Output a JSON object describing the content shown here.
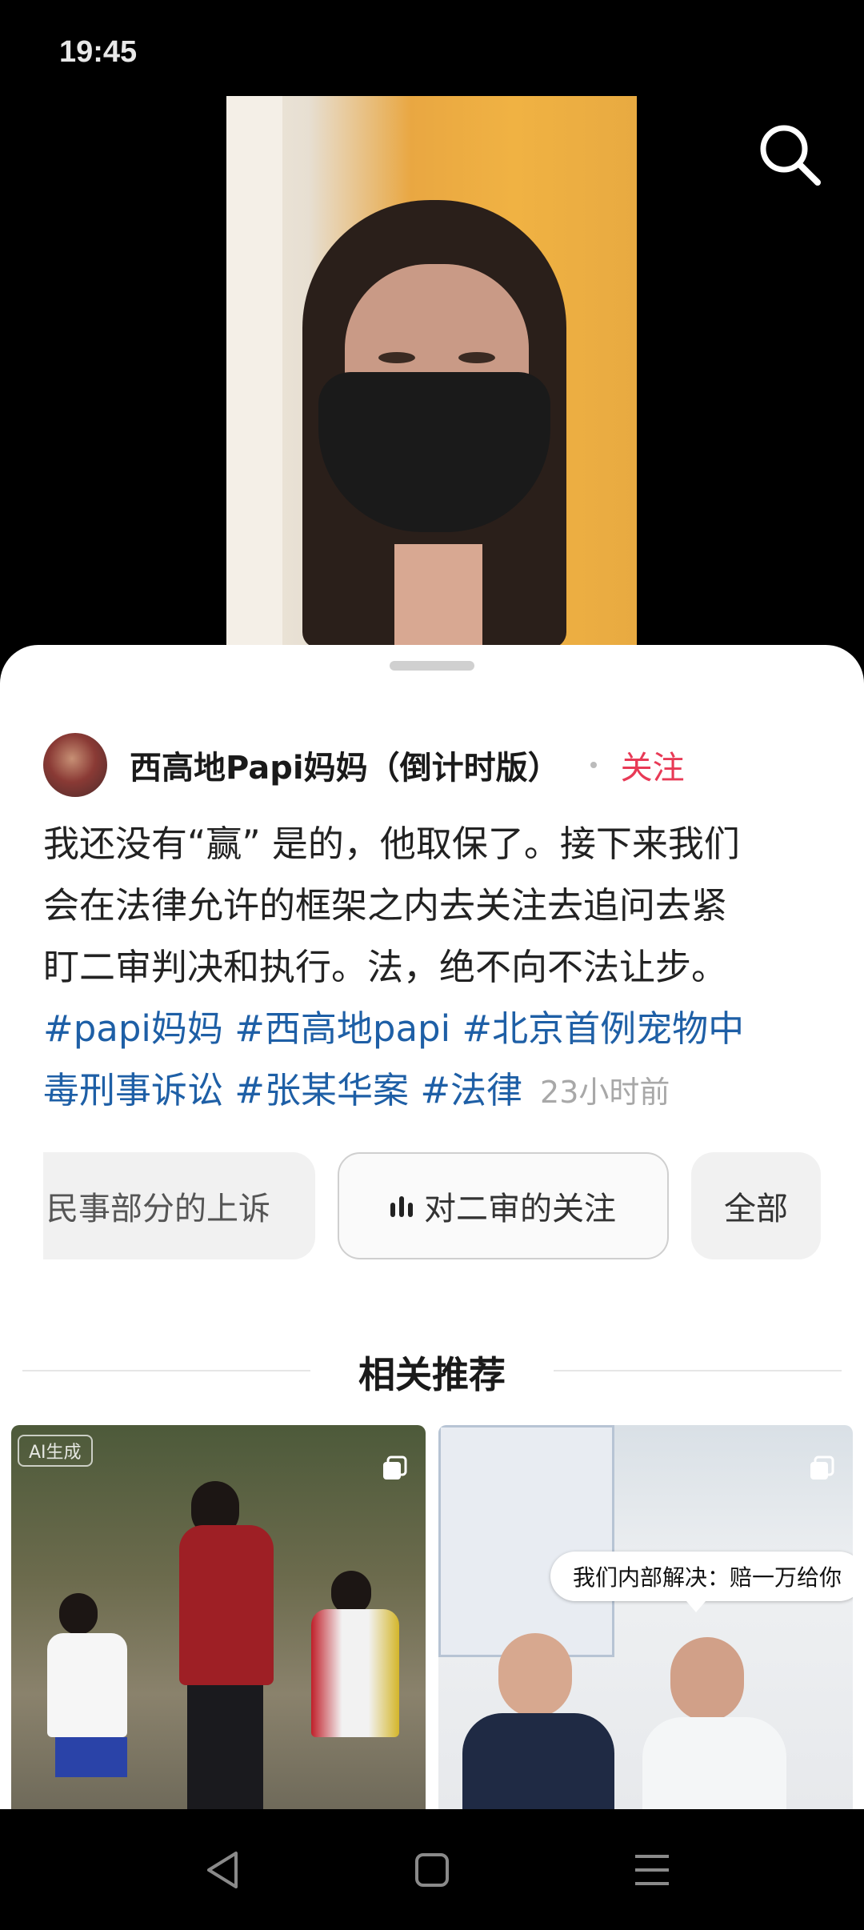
{
  "status_bar": {
    "time": "19:45"
  },
  "video": {
    "search_icon": "search-icon"
  },
  "post": {
    "author_name": "西高地Papi妈妈（倒计时版）",
    "follow_label": "关注",
    "text_lines": [
      "我还没有“赢” 是的，他取保了。接下来我们",
      "会在法律允许的框架之内去关注去追问去紧",
      "盯二审判决和执行。法，绝不向不法让步。"
    ],
    "tags_line1": "#papi妈妈 #西高地papi #北京首例宠物中",
    "tags_line2": "毒刑事诉讼 #张某华案 #法律",
    "time_ago": "23小时前"
  },
  "chips": [
    {
      "label": "民事部分的上诉"
    },
    {
      "label": "对二审的关注",
      "icon": "audio-bars-icon"
    },
    {
      "label": "全部"
    }
  ],
  "recommendations": {
    "title": "相关推荐",
    "card1_badge": "AI生成",
    "card2_caption": "我们内部解决：赔一万给你"
  },
  "nav_bar": {
    "back_icon": "back-triangle-icon",
    "home_icon": "home-square-icon",
    "menu_icon": "menu-lines-icon"
  }
}
